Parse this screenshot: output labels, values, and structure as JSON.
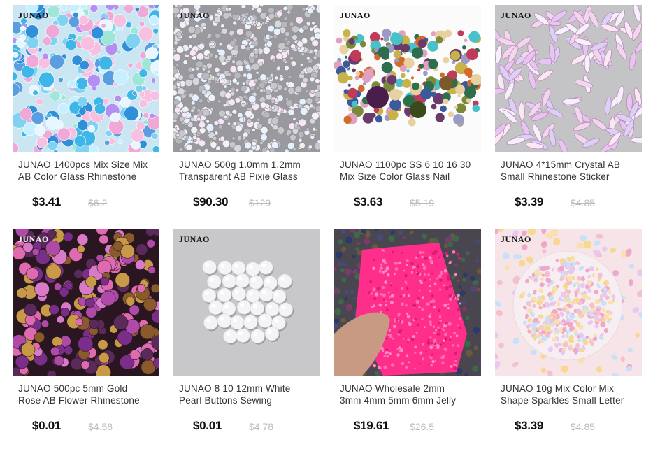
{
  "products": [
    {
      "brand": "JUNAO",
      "title_line1": "JUNAO 1400pcs Mix Size Mix",
      "title_line2": "AB Color Glass Rhinestone",
      "price": "$3.41",
      "old_price": "$6.2"
    },
    {
      "brand": "JUNAO",
      "title_line1": "JUNAO 500g 1.0mm 1.2mm",
      "title_line2": "Transparent AB Pixie Glass",
      "price": "$90.30",
      "old_price": "$129"
    },
    {
      "brand": "JUNAO",
      "title_line1": "JUNAO 1100pc SS 6 10 16 30",
      "title_line2": "Mix Size Color Glass Nail",
      "price": "$3.63",
      "old_price": "$5.19"
    },
    {
      "brand": "JUNAO",
      "title_line1": "JUNAO 4*15mm Crystal AB",
      "title_line2": "Small Rhinestone Sticker",
      "price": "$3.39",
      "old_price": "$4.85"
    },
    {
      "brand": "JUNAO",
      "title_line1": "JUNAO 500pc 5mm Gold",
      "title_line2": "Rose AB Flower Rhinestone",
      "price": "$0.01",
      "old_price": "$4.58"
    },
    {
      "brand": "JUNAO",
      "title_line1": "JUNAO 8 10 12mm White",
      "title_line2": "Pearl Buttons Sewing",
      "price": "$0.01",
      "old_price": "$4.78"
    },
    {
      "brand": "",
      "title_line1": "JUNAO Wholesale 2mm",
      "title_line2": "3mm 4mm 5mm 6mm Jelly",
      "price": "$19.61",
      "old_price": "$26.5"
    },
    {
      "brand": "JUNAO",
      "title_line1": "JUNAO 10g Mix Color Mix",
      "title_line2": "Shape Sparkles Small Letter",
      "price": "$3.39",
      "old_price": "$4.85"
    }
  ]
}
